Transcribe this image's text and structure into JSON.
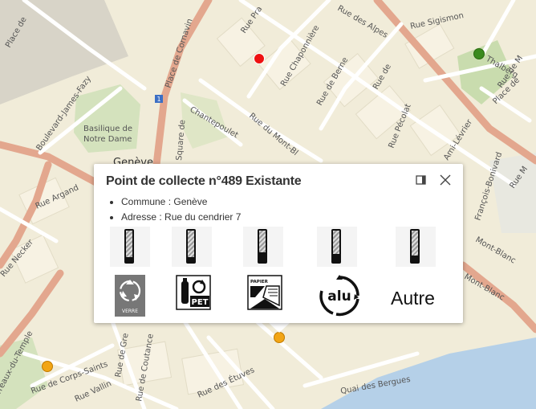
{
  "map": {
    "labels": {
      "place_cornavin": "Place de Cornavin",
      "place_de": "Place de",
      "rue_pradier": "Rue Pra",
      "rue_alpes": "Rue des Alpes",
      "rue_sigismond": "Rue Sigismon",
      "rue_thalberg": "Thalberg",
      "place_de2": "Place de",
      "rue_chaponniere": "Rue Chaponnière",
      "rue_berne": "Rue de Berne",
      "rue_neuve": "Rue de",
      "bd_fazy": "Boulevard-James-Fazy",
      "basilique": "Basilique de",
      "notre_dame": "Notre Dame",
      "square": "Square de",
      "chantepoulet": "Chantepoulet",
      "rue_mont_blanc": "Rue du Mont-Bl",
      "rue_pecolat": "Rue Pécolat",
      "ami_levrier": "Ami-Lévrier",
      "rue_monthoux": "Rue de M",
      "geneve": "Genève",
      "rue_argand": "Rue Argand",
      "rue_necker": "Rue Necker",
      "terreaux": "Terreaux-du-Temple",
      "corps_saints": "Rue de Corps-Saints",
      "rue_vallin": "Rue Vallin",
      "rue_grenus": "Rue de Gre",
      "rue_coutance": "Rue de Coutance",
      "etuves": "Rue des Étuves",
      "bergues": "Quai des Bergues",
      "francois_bonivard": "François-Bonivard",
      "mont_blanc2": "Mont-Blanc",
      "mont_blanc3": "Mont-Blanc",
      "rue_m": "Rue M",
      "route_sign": "1"
    }
  },
  "popup": {
    "title": "Point de collecte n°489 Existante",
    "commune": "Commune : Genève",
    "adresse": "Adresse : Rue du cendrier 7",
    "dock_icon": "dock-icon",
    "close_icon": "close-icon",
    "fill_levels": [
      0.15,
      0.15,
      0.3,
      0.25,
      0.2
    ],
    "logos": {
      "verre": "VERRE",
      "pet": "PET",
      "papier": "PAPIER",
      "alu": "alu",
      "autre": "Autre"
    }
  },
  "colors": {
    "marker_red": "#ee1111",
    "marker_green": "#3a8a1e",
    "marker_orange": "#f2a515",
    "road_major": "#e3a78e",
    "water": "#b5d0e8"
  }
}
